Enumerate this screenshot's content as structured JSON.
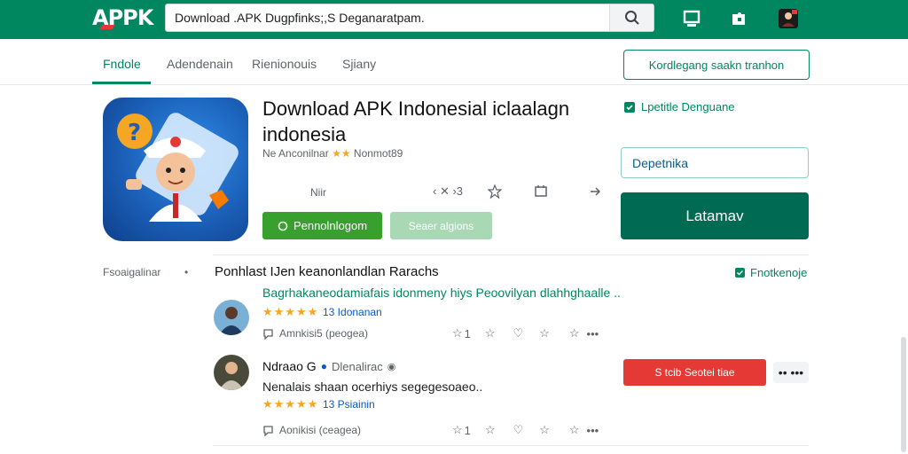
{
  "header": {
    "logo_text": "APPK",
    "search": {
      "value": "Download .APK Dugpfinks;,S Deganaratpam."
    },
    "icons": [
      "search-icon",
      "monitor-icon",
      "puzzle-icon",
      "user-avatar-icon"
    ]
  },
  "tabs": [
    {
      "label": "Fndole",
      "active": true
    },
    {
      "label": "Adendenain",
      "active": false
    },
    {
      "label": "Rienionouis",
      "active": false
    },
    {
      "label": "Sjiany",
      "active": false
    }
  ],
  "header_action": {
    "label": "Kordlegang saakn tranhon"
  },
  "app": {
    "title": "Download APK Indonesial iclaalagn indonesia",
    "meta_prefix": "Ne Anconilnar",
    "meta_badge": "★★",
    "meta_suffix": "Nonmot89",
    "size": "Niir",
    "share_count": "‹ ✕ ›3",
    "install_label": "Pennolnlogom",
    "secondary_label": "Seaer algions"
  },
  "right": {
    "verified_label": "Lpetitle Denguane",
    "input_value": "Depetnika",
    "primary_label": "Latamav"
  },
  "reviews": {
    "side_label": "Fsoaigalinar",
    "side_dot": "•",
    "heading": "Ponhlast IJen keanonlandlan Rarachs",
    "summary": "Bagrhakaneodamiafais idonmeny hiys Peoovilyan dlahhghaalle ..",
    "link_label": "Fnotkenoje",
    "items": [
      {
        "rating_text": "13  Idonanan",
        "action_label": "Amnkisi5  (peogea)",
        "like_count": "1"
      },
      {
        "author": "Ndraao G",
        "author_sub": "Dlenalirac",
        "body": "Nenalais shaan ocerhiys segegesoaeo..",
        "rating_text": "13  Psiainin",
        "action_label": "Aonikisi  (ceagea)",
        "like_count": "1",
        "report_label": "S  tcib  Seotei tiae",
        "more_label": "•• •••"
      }
    ]
  },
  "colors": {
    "brand_green": "#01875f",
    "install_green": "#38a12d",
    "primary_dark": "#016a53",
    "danger_red": "#e53935",
    "star_yellow": "#f5a623"
  }
}
